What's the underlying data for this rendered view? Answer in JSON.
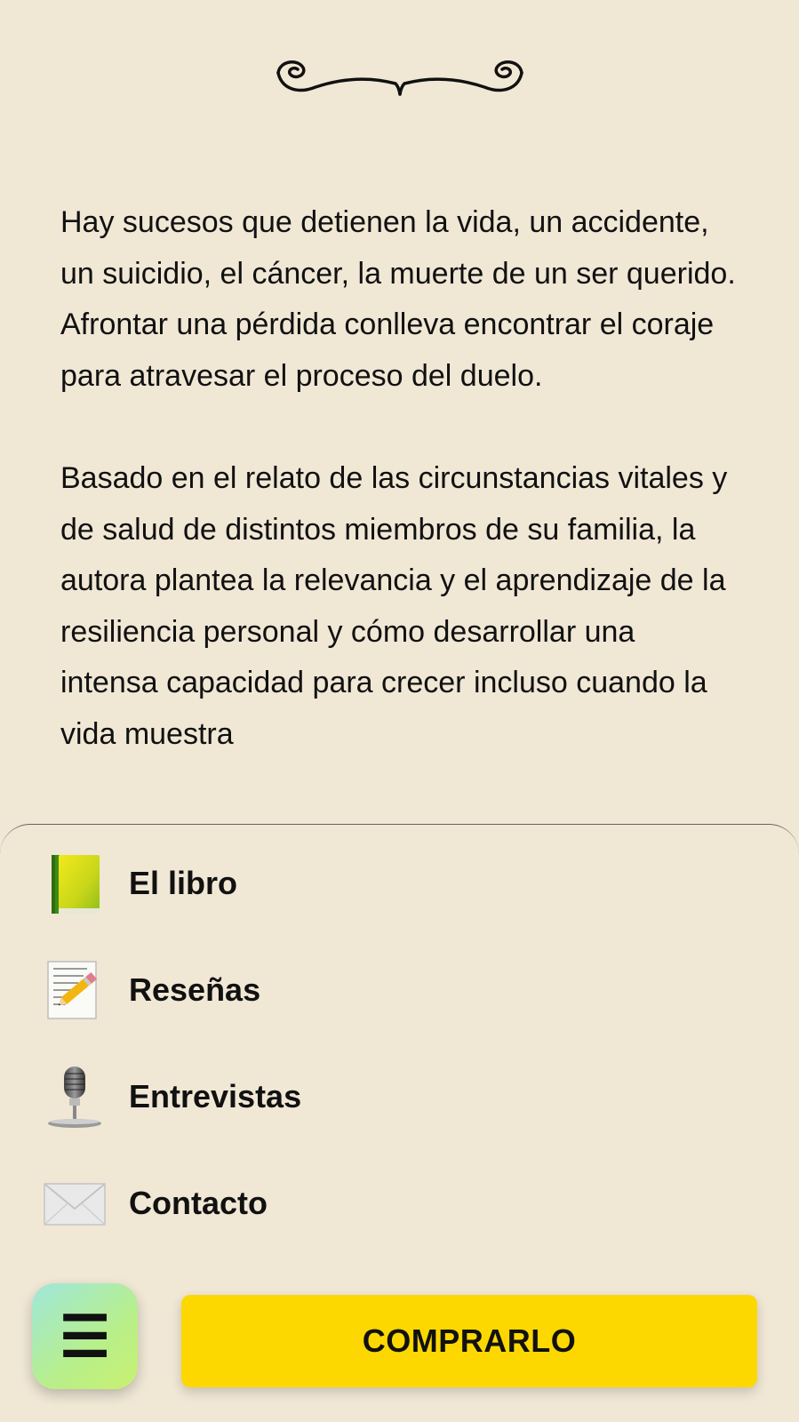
{
  "ornament": {
    "icon": "flourish-divider-icon"
  },
  "intro": {
    "paragraphs": [
      "Hay sucesos que detienen la vida, un accidente, un suicidio, el cáncer, la muerte de un ser querido. Afrontar una pérdida conlleva encontrar el coraje para atravesar el proceso del duelo.",
      "Basado en el relato de las circunstancias vitales y de salud de distintos miembros de su familia, la autora plantea la relevancia y el aprendizaje de la resiliencia personal y cómo desarrollar una intensa capacidad para crecer incluso cuando la vida muestra"
    ]
  },
  "menu": {
    "items": [
      {
        "label": "El libro",
        "icon": "book-icon"
      },
      {
        "label": "Reseñas",
        "icon": "memo-pencil-icon"
      },
      {
        "label": "Entrevistas",
        "icon": "microphone-icon"
      },
      {
        "label": "Contacto",
        "icon": "envelope-icon"
      }
    ]
  },
  "footer": {
    "menu_toggle_glyph": "☰",
    "menu_toggle_icon": "hamburger-menu-icon",
    "buy_label": "COMPRARLO"
  },
  "colors": {
    "background": "#f0e7d5",
    "buy_button": "#fdd800",
    "menu_button_gradient_start": "#9fe7dc",
    "menu_button_gradient_end": "#c9f070"
  }
}
